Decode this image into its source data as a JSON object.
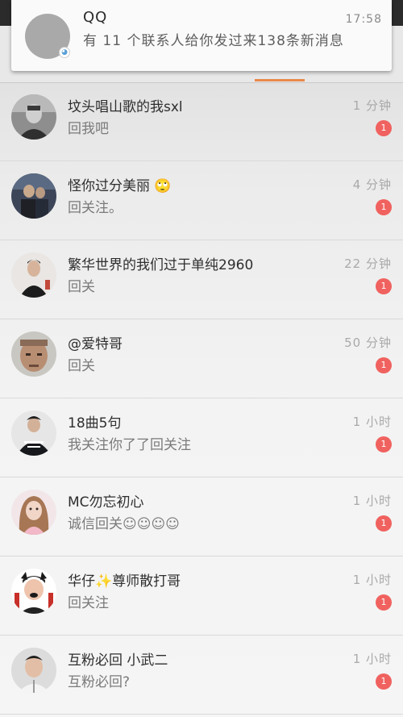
{
  "notification": {
    "app_name": "QQ",
    "time": "17:58",
    "message": "有 11 个联系人给你发过来138条新消息",
    "avatar_badge_icon": "qq-penguin-icon"
  },
  "colors": {
    "accent_tab": "#e8894a",
    "unread_badge": "#f0625f"
  },
  "conversations": [
    {
      "name": "坟头唱山歌的我sxl",
      "preview": "回我吧",
      "time": "1 分钟",
      "unread": "1"
    },
    {
      "name": "怪你过分美丽 🙄",
      "preview": "回关注。",
      "time": "4 分钟",
      "unread": "1"
    },
    {
      "name": "繁华世界的我们过于单纯2960",
      "preview": "回关",
      "time": "22 分钟",
      "unread": "1"
    },
    {
      "name": "@爱特哥",
      "preview": "回关",
      "time": "50 分钟",
      "unread": "1"
    },
    {
      "name": "18曲5句",
      "preview": "我关注你了了回关注",
      "time": "1 小时",
      "unread": "1"
    },
    {
      "name": "MC勿忘初心",
      "preview": "诚信回关☺☺☺☺",
      "time": "1 小时",
      "unread": "1"
    },
    {
      "name": "华仔✨尊师散打哥",
      "preview": "回关注",
      "time": "1 小时",
      "unread": "1"
    },
    {
      "name": "互粉必回  小武二",
      "preview": "互粉必回?",
      "time": "1 小时",
      "unread": "1"
    }
  ]
}
